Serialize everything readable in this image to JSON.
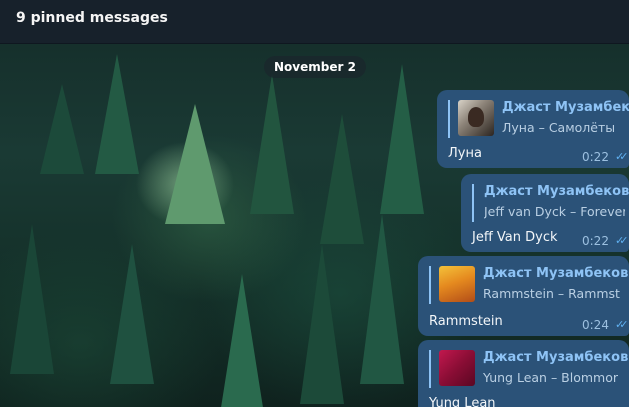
{
  "header": {
    "title": "9 pinned messages"
  },
  "date_separator": "November 2",
  "messages": [
    {
      "reply_name": "Джаст Музамбеков",
      "reply_sub": "Луна – Самолёты",
      "text": "Луна",
      "time": "0:22",
      "thumb": "photo"
    },
    {
      "reply_name": "Джаст Музамбеков",
      "reply_sub": "Jeff van Dyck – Forever",
      "text": "Jeff Van Dyck",
      "time": "0:22",
      "thumb": "none"
    },
    {
      "reply_name": "Джаст Музамбеков",
      "reply_sub": "Rammstein – Rammst",
      "text": "Rammstein",
      "time": "0:24",
      "thumb": "album"
    },
    {
      "reply_name": "Джаст Музамбеков",
      "reply_sub": "Yung Lean – Blommor",
      "text": "Yung Lean",
      "time": "",
      "thumb": "album"
    }
  ],
  "colors": {
    "header_bg": "#17212b",
    "bubble_bg": "#2b5278",
    "accent": "#8ec3f5",
    "check": "#5fb0f0"
  },
  "icons": {
    "read_receipt": "double-check-icon"
  }
}
